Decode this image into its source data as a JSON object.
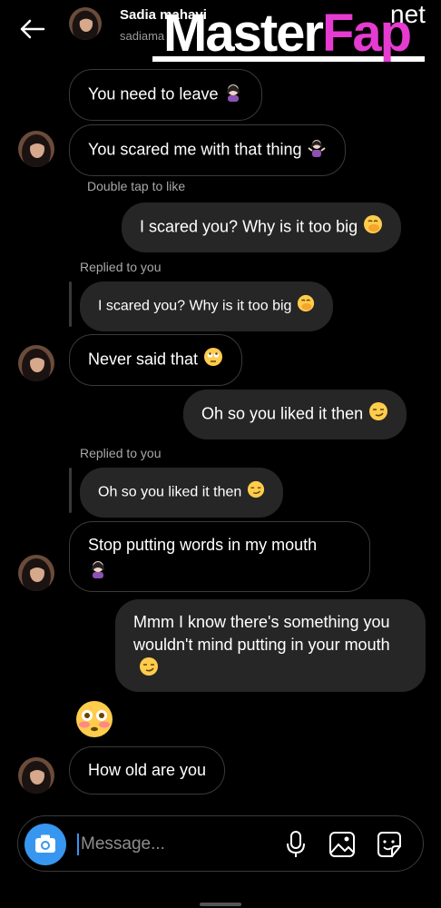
{
  "header": {
    "contact_name": "Sadia mahavi",
    "contact_handle": "sadiama"
  },
  "watermark": {
    "part1": "Master",
    "part2": "Fap",
    "suffix": "net"
  },
  "messages": [
    {
      "type": "incoming",
      "text": "You need to leave"
    },
    {
      "type": "incoming",
      "text": "You scared me with that thing"
    },
    {
      "type": "meta",
      "text": "Double tap to like"
    },
    {
      "type": "outgoing",
      "text": "I scared you? Why is it too big"
    },
    {
      "type": "meta",
      "text": "Replied to you"
    },
    {
      "type": "reply_quote",
      "text": "I scared you? Why is it too big"
    },
    {
      "type": "incoming",
      "text": "Never said that"
    },
    {
      "type": "outgoing",
      "text": "Oh so you liked it then"
    },
    {
      "type": "meta",
      "text": "Replied to you"
    },
    {
      "type": "reply_quote",
      "text": "Oh so you liked it then"
    },
    {
      "type": "incoming",
      "text": "Stop putting words in my mouth"
    },
    {
      "type": "outgoing",
      "text": "Mmm I know there's something you wouldn't mind putting in your mouth"
    },
    {
      "type": "incoming_emoji",
      "text": "flushed-face"
    },
    {
      "type": "incoming",
      "text": "How old are you"
    }
  ],
  "composer": {
    "placeholder": "Message..."
  },
  "icons": {
    "back": "back-arrow-icon",
    "camera": "camera-icon",
    "mic": "microphone-icon",
    "gallery": "image-icon",
    "sticker": "sticker-icon"
  },
  "colors": {
    "accent": "#3797f0",
    "outgoing_bubble": "#262626",
    "watermark_accent": "#e63bd0"
  }
}
